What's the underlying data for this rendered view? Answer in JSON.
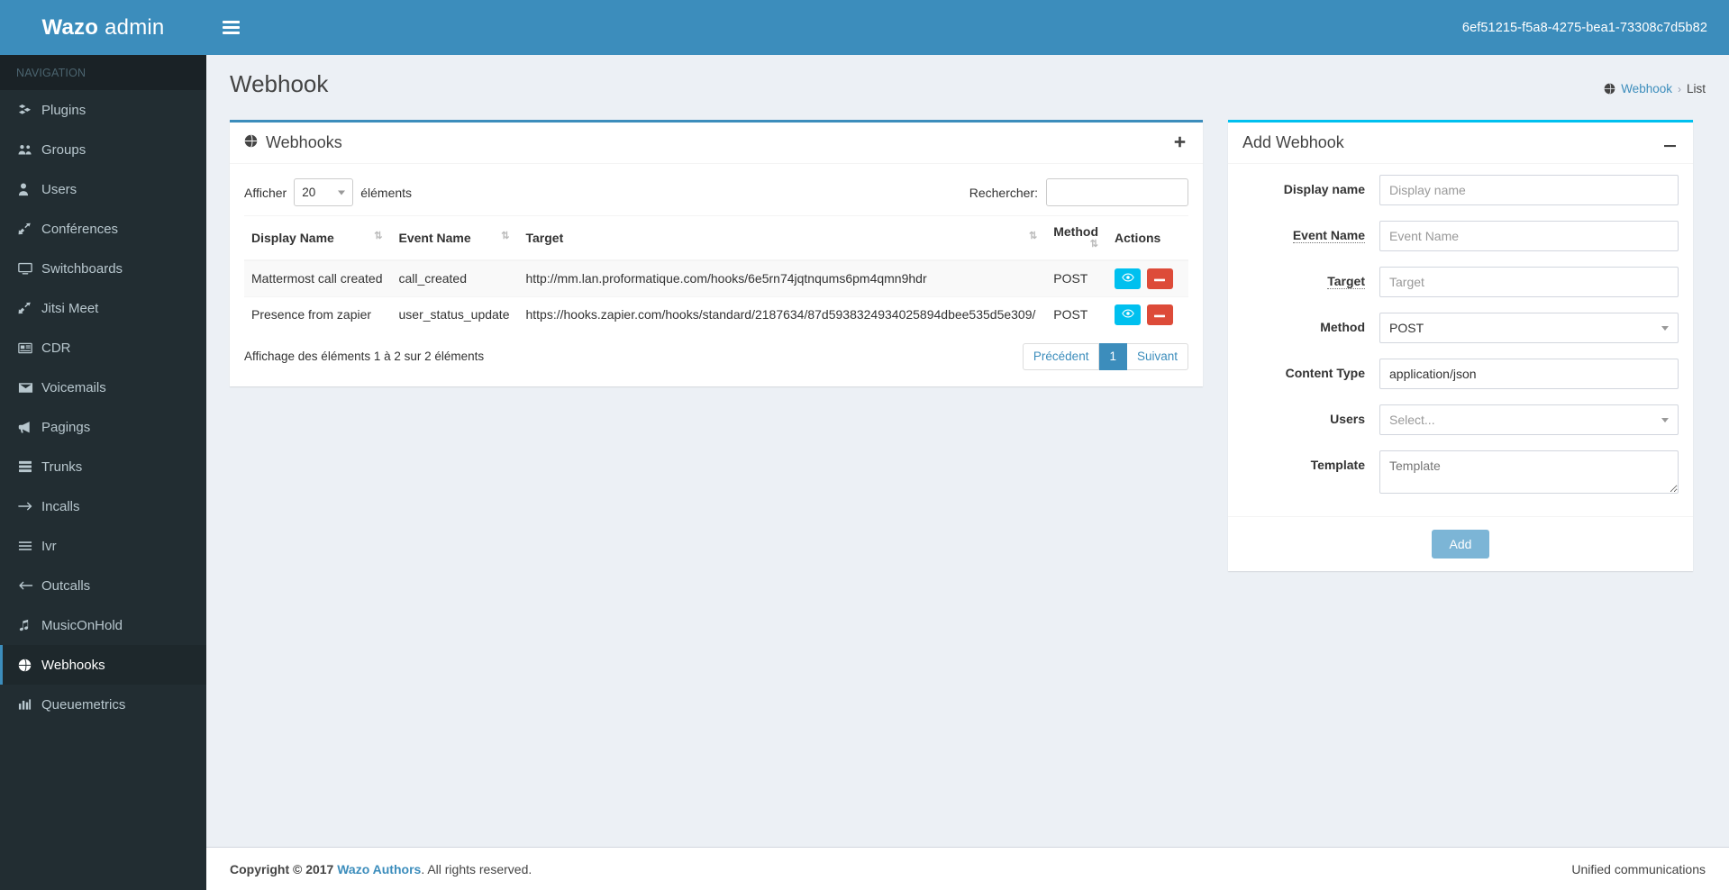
{
  "brand": {
    "strong": "Wazo",
    "light": "admin"
  },
  "topbar": {
    "uuid": "6ef51215-f5a8-4275-bea1-73308c7d5b82",
    "menu_icon": "hamburger-icon"
  },
  "sidebar": {
    "nav_header": "NAVIGATION",
    "items": [
      {
        "label": "Plugins",
        "icon": "plugins-icon",
        "active": false
      },
      {
        "label": "Groups",
        "icon": "groups-icon",
        "active": false
      },
      {
        "label": "Users",
        "icon": "user-icon",
        "active": false
      },
      {
        "label": "Conférences",
        "icon": "conference-icon",
        "active": false
      },
      {
        "label": "Switchboards",
        "icon": "desktop-icon",
        "active": false
      },
      {
        "label": "Jitsi Meet",
        "icon": "conference-icon",
        "active": false
      },
      {
        "label": "CDR",
        "icon": "newspaper-icon",
        "active": false
      },
      {
        "label": "Voicemails",
        "icon": "envelope-icon",
        "active": false
      },
      {
        "label": "Pagings",
        "icon": "bullhorn-icon",
        "active": false
      },
      {
        "label": "Trunks",
        "icon": "server-icon",
        "active": false
      },
      {
        "label": "Incalls",
        "icon": "arrow-right-icon",
        "active": false
      },
      {
        "label": "Ivr",
        "icon": "bars-icon",
        "active": false
      },
      {
        "label": "Outcalls",
        "icon": "arrow-left-icon",
        "active": false
      },
      {
        "label": "MusicOnHold",
        "icon": "music-icon",
        "active": false
      },
      {
        "label": "Webhooks",
        "icon": "globe-icon",
        "active": true
      },
      {
        "label": "Queuemetrics",
        "icon": "bar-chart-icon",
        "active": false
      }
    ]
  },
  "page": {
    "title": "Webhook",
    "breadcrumb": {
      "icon": "globe-icon",
      "root": "Webhook",
      "separator": "›",
      "current": "List"
    }
  },
  "webhooks_box": {
    "title": "Webhooks",
    "title_icon": "globe-icon",
    "add_icon": "plus-icon",
    "length_label_before": "Afficher",
    "length_value": "20",
    "length_label_after": "éléments",
    "search_label": "Rechercher:",
    "search_value": "",
    "columns": [
      "Display Name",
      "Event Name",
      "Target",
      "Method",
      "Actions"
    ],
    "rows": [
      {
        "display_name": "Mattermost call created",
        "event_name": "call_created",
        "target": "http://mm.lan.proformatique.com/hooks/6e5rn74jqtnqums6pm4qmn9hdr",
        "method": "POST",
        "actions": {
          "view_icon": "eye-icon",
          "delete_icon": "minus-icon"
        }
      },
      {
        "display_name": "Presence from zapier",
        "event_name": "user_status_update",
        "target": "https://hooks.zapier.com/hooks/standard/2187634/87d5938324934025894dbee535d5e309/",
        "method": "POST",
        "actions": {
          "view_icon": "eye-icon",
          "delete_icon": "minus-icon"
        }
      }
    ],
    "info": "Affichage des éléments 1 à 2 sur 2 éléments",
    "pagination": {
      "prev": "Précédent",
      "pages": [
        "1"
      ],
      "next": "Suivant",
      "current": "1"
    }
  },
  "add_box": {
    "title": "Add Webhook",
    "collapse_icon": "minus-icon",
    "fields": {
      "display_name": {
        "label": "Display name",
        "placeholder": "Display name",
        "value": ""
      },
      "event_name": {
        "label": "Event Name",
        "placeholder": "Event Name",
        "value": ""
      },
      "target": {
        "label": "Target",
        "placeholder": "Target",
        "value": ""
      },
      "method": {
        "label": "Method",
        "value": "POST"
      },
      "content_type": {
        "label": "Content Type",
        "value": "application/json"
      },
      "users": {
        "label": "Users",
        "value": "Select..."
      },
      "template": {
        "label": "Template",
        "placeholder": "Template",
        "value": ""
      }
    },
    "submit_label": "Add"
  },
  "footer": {
    "copyright_prefix": "Copyright © 2017",
    "link": "Wazo Authors",
    "copyright_suffix": ". All rights reserved.",
    "right": "Unified communications"
  },
  "colors": {
    "brand_blue": "#3c8dbc",
    "sidebar_dark": "#222d32",
    "info_cyan": "#00c0ef",
    "danger_red": "#dd4b39",
    "page_bg": "#ecf0f5"
  }
}
